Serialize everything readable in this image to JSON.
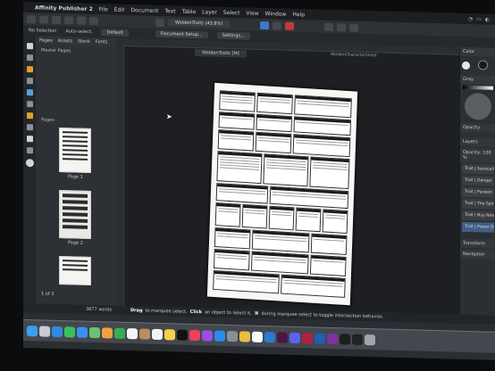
{
  "menubar": {
    "app_name": "Affinity Publisher 2",
    "items": [
      "File",
      "Edit",
      "Document",
      "Text",
      "Table",
      "Layer",
      "Select",
      "View",
      "Window",
      "Help"
    ]
  },
  "context_bar": {
    "selection": "No Selection",
    "auto_select": "Auto-select:",
    "auto_select_value": "Default",
    "document_setup": "Document Setup...",
    "settings": "Settings..."
  },
  "toolbar": {
    "zoom_label": "WoldenTraits (43.8%)"
  },
  "pages_panel": {
    "tabs": [
      "Pages",
      "Assets",
      "Stock",
      "Fonts"
    ],
    "master_section": "Master Pages",
    "pages_section": "Pages",
    "pages": [
      {
        "caption": "Page 1"
      },
      {
        "caption": "Page 2"
      }
    ],
    "page_count": "1 of 3"
  },
  "canvas": {
    "doc_tab": "WoldenTraits [M]",
    "spread_label": "WoldenCharacterSheet"
  },
  "right_panel": {
    "color_tab": "Color",
    "gray_label": "Gray",
    "opacity_label": "Opacity",
    "layers_tab": "Layers",
    "character_tab": "Character",
    "opacity_value": "Opacity: 100 %",
    "layers": [
      {
        "name": "Trait | Sensuality",
        "selected": false
      },
      {
        "name": "Trait | Danger",
        "selected": false
      },
      {
        "name": "Trait | Passion",
        "selected": false
      },
      {
        "name": "Trait | The Spirits",
        "selected": false
      },
      {
        "name": "Trait | Buy Now",
        "selected": false
      },
      {
        "name": "Trait | Power Demands",
        "selected": false
      }
    ],
    "transform_tab": "Transform",
    "navigator_tab": "Navigator"
  },
  "status_bar": {
    "drag_word": "Drag",
    "drag_text": "to marquee select.",
    "click_word": "Click",
    "click_text": "an object to select it.",
    "modifier_word": "⌘",
    "modifier_text": "during marquee select to toggle intersection behavior.",
    "word_count": "3877 words"
  },
  "colors": {
    "accent": "#3b7ac7",
    "selected_layer": "#3f5f86",
    "canvas_bg": "#1d1f22",
    "panel_bg": "#2d3034"
  },
  "dock_icons": [
    "finder",
    "launchpad",
    "safari",
    "messages",
    "mail",
    "maps",
    "photos",
    "facetime",
    "calendar",
    "contacts",
    "reminders",
    "notes",
    "tv",
    "music",
    "podcasts",
    "app-store",
    "settings",
    "chrome",
    "notion",
    "vscode",
    "slack",
    "discord",
    "affinity-publisher",
    "affinity-designer",
    "affinity-photo",
    "figma",
    "terminal",
    "trash"
  ]
}
